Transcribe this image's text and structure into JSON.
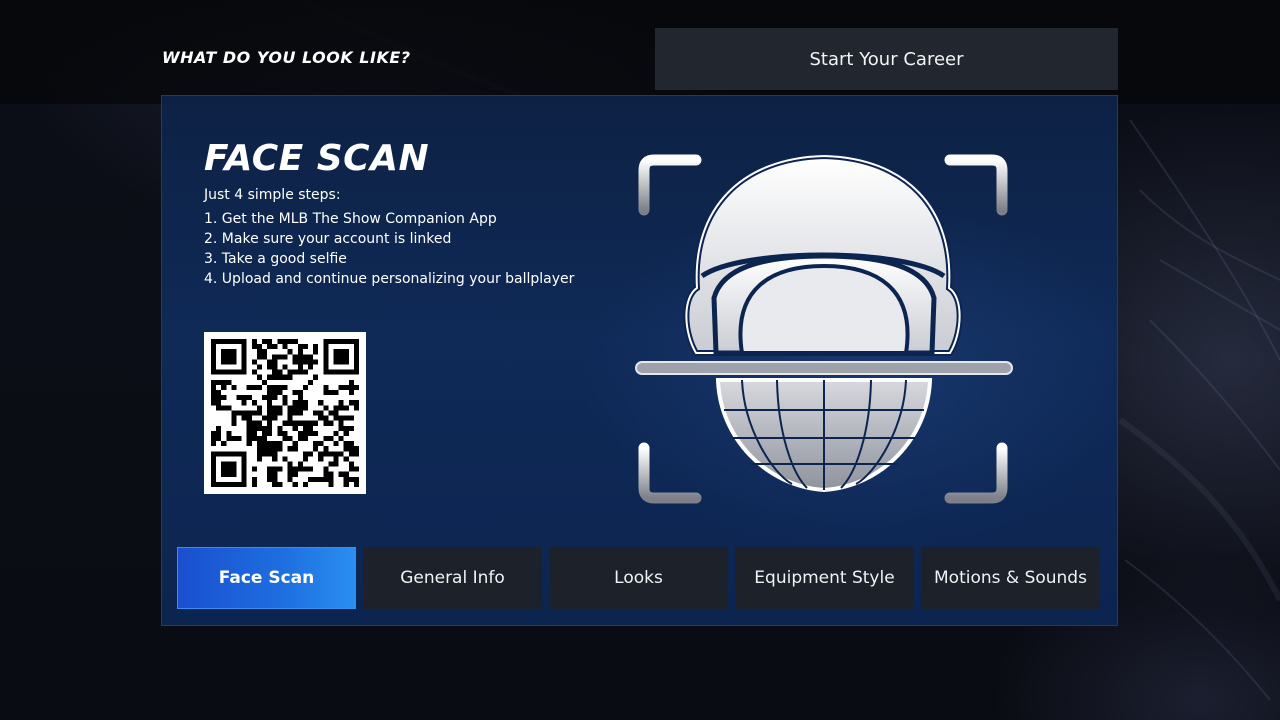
{
  "header": {
    "title": "WHAT DO YOU LOOK LIKE?",
    "start_career_label": "Start Your Career"
  },
  "face_scan": {
    "title": "FACE SCAN",
    "intro": "Just 4 simple steps:",
    "steps": [
      "1. Get the MLB The Show Companion App",
      "2. Make sure your account is linked",
      "3. Take a good selfie",
      "4. Upload and continue personalizing your ballplayer"
    ]
  },
  "tabs": [
    {
      "label": "Face Scan",
      "active": true
    },
    {
      "label": "General Info",
      "active": false
    },
    {
      "label": "Looks",
      "active": false
    },
    {
      "label": "Equipment Style",
      "active": false
    },
    {
      "label": "Motions & Sounds",
      "active": false
    }
  ],
  "colors": {
    "panel_bg": "#0f2a57",
    "tab_active": "#1e6fe0",
    "tab_inactive": "#1c212a",
    "button_bg": "#22262e"
  },
  "icons": {
    "qr_code": "qr-code-icon",
    "face_scan_graphic": "helmet-face-scan-icon"
  }
}
